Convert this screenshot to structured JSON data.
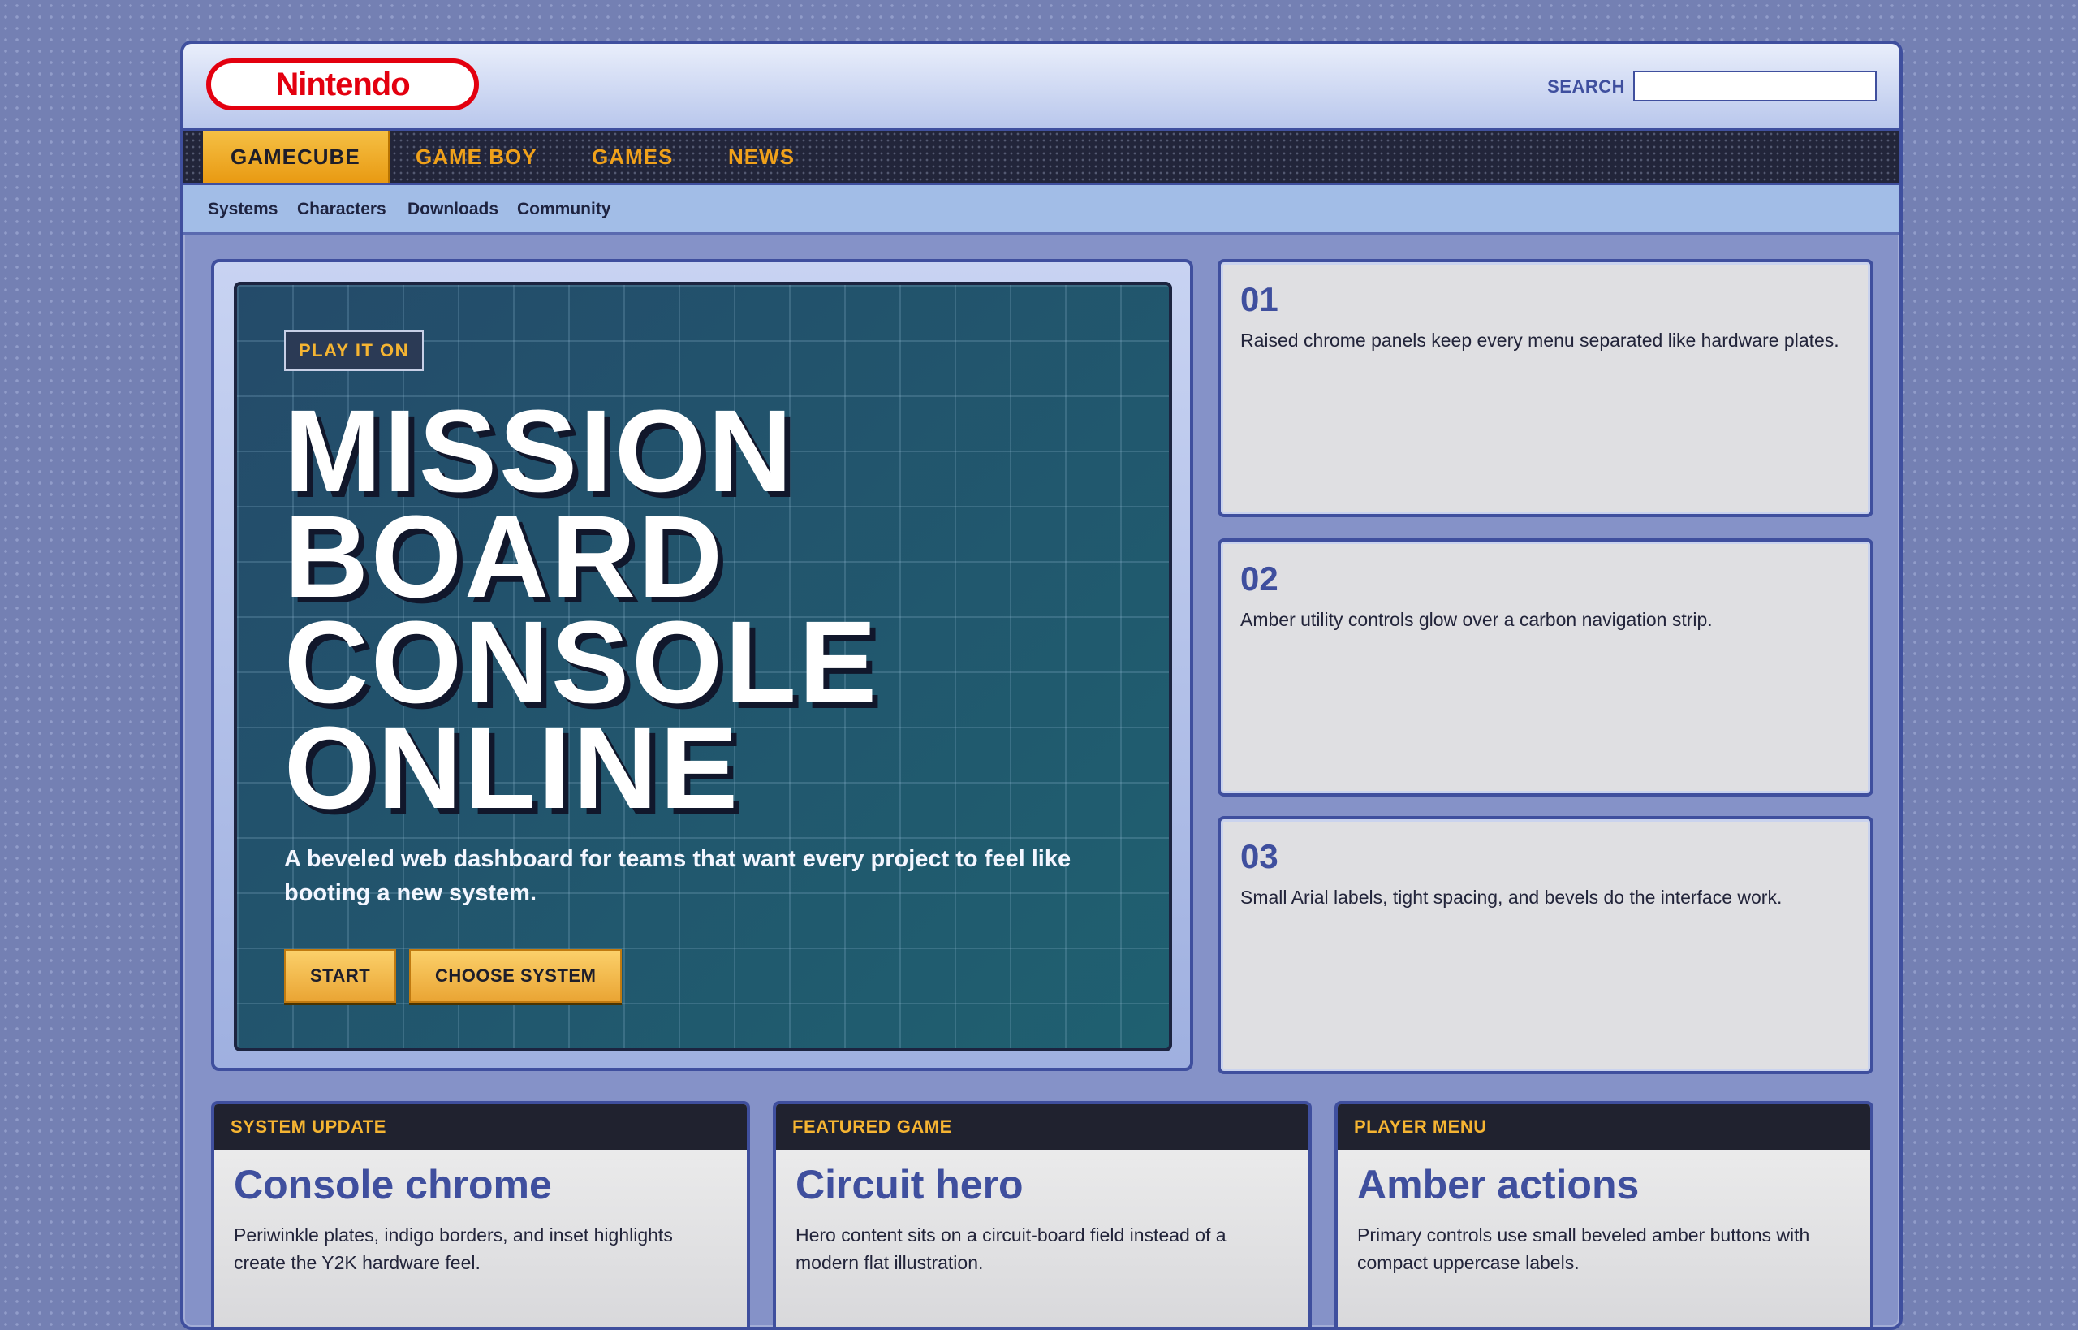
{
  "header": {
    "logo_text": "Nintendo",
    "search_label": "SEARCH",
    "search_value": "",
    "search_placeholder": ""
  },
  "main_nav": {
    "tabs": [
      {
        "label": "GAMECUBE",
        "active": true
      },
      {
        "label": "GAME BOY",
        "active": false
      },
      {
        "label": "GAMES",
        "active": false
      },
      {
        "label": "NEWS",
        "active": false
      }
    ]
  },
  "sub_nav": {
    "items": [
      "Systems",
      "Characters",
      "Downloads",
      "Community"
    ]
  },
  "hero": {
    "eyebrow": "PLAY IT ON",
    "title_lines": [
      "MISSION",
      "BOARD",
      "CONSOLE",
      "ONLINE"
    ],
    "subtitle": "A beveled web dashboard for teams that want every project to feel like booting a new system.",
    "buttons": [
      "START",
      "CHOOSE SYSTEM"
    ]
  },
  "features": [
    {
      "number": "01",
      "text": "Raised chrome panels keep every menu separated like hardware plates."
    },
    {
      "number": "02",
      "text": "Amber utility controls glow over a carbon navigation strip."
    },
    {
      "number": "03",
      "text": "Small Arial labels, tight spacing, and bevels do the interface work."
    }
  ],
  "cards": [
    {
      "caption": "SYSTEM UPDATE",
      "title": "Console chrome",
      "body": "Periwinkle plates, indigo borders, and inset highlights create the Y2K hardware feel."
    },
    {
      "caption": "FEATURED GAME",
      "title": "Circuit hero",
      "body": "Hero content sits on a circuit-board field instead of a modern flat illustration."
    },
    {
      "caption": "PLAYER MENU",
      "title": "Amber actions",
      "body": "Primary controls use small beveled amber buttons with compact uppercase labels."
    }
  ],
  "colors": {
    "indigo": "#3f4f9e",
    "amber": "#f5b432",
    "nintendo_red": "#e3000f",
    "carbon": "#22253a",
    "periwinkle": "#8592c8"
  }
}
